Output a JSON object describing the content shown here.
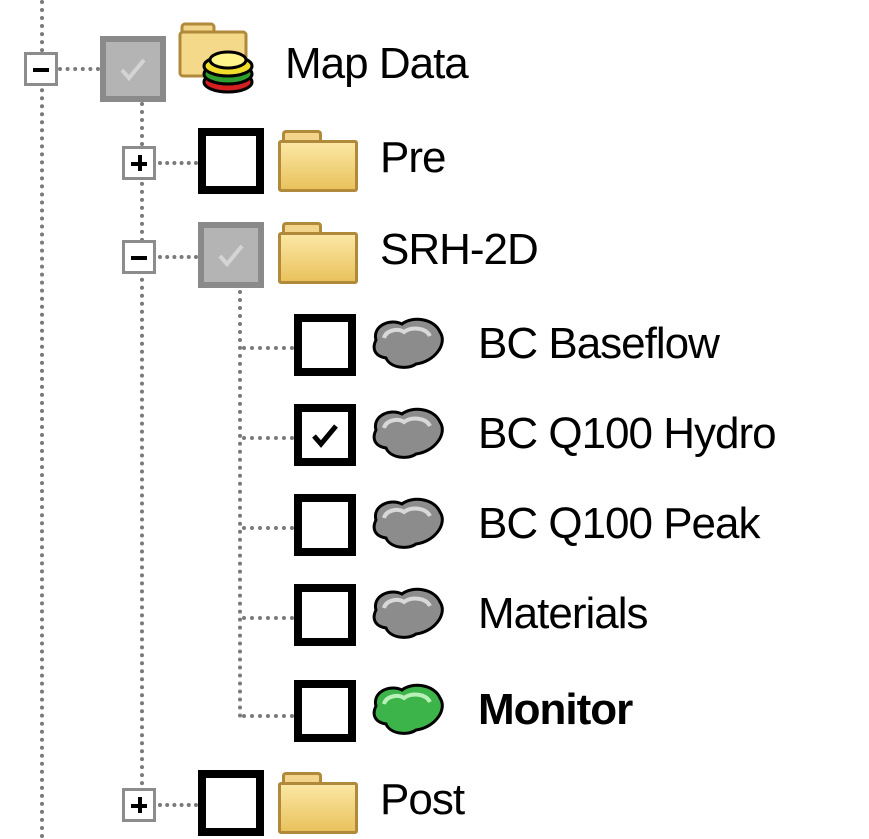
{
  "tree": {
    "root": {
      "label": "Map Data",
      "expanded": true,
      "check_state": "partial",
      "icon": "map-data-folder-icon",
      "children": [
        {
          "label": "Pre",
          "expanded": false,
          "checked": false,
          "icon": "folder-icon"
        },
        {
          "label": "SRH-2D",
          "expanded": true,
          "check_state": "partial",
          "icon": "folder-icon",
          "children": [
            {
              "label": "BC Baseflow",
              "checked": false,
              "icon": "coverage-icon",
              "icon_color": "#8c8c8c"
            },
            {
              "label": "BC Q100 Hydro",
              "checked": true,
              "icon": "coverage-icon",
              "icon_color": "#8c8c8c"
            },
            {
              "label": "BC Q100 Peak",
              "checked": false,
              "icon": "coverage-icon",
              "icon_color": "#8c8c8c"
            },
            {
              "label": "Materials",
              "checked": false,
              "icon": "coverage-icon",
              "icon_color": "#8c8c8c"
            },
            {
              "label": "Monitor",
              "checked": false,
              "active": true,
              "icon": "coverage-icon",
              "icon_color": "#3cb44a"
            }
          ]
        },
        {
          "label": "Post",
          "expanded": false,
          "checked": false,
          "icon": "folder-icon"
        }
      ]
    }
  }
}
